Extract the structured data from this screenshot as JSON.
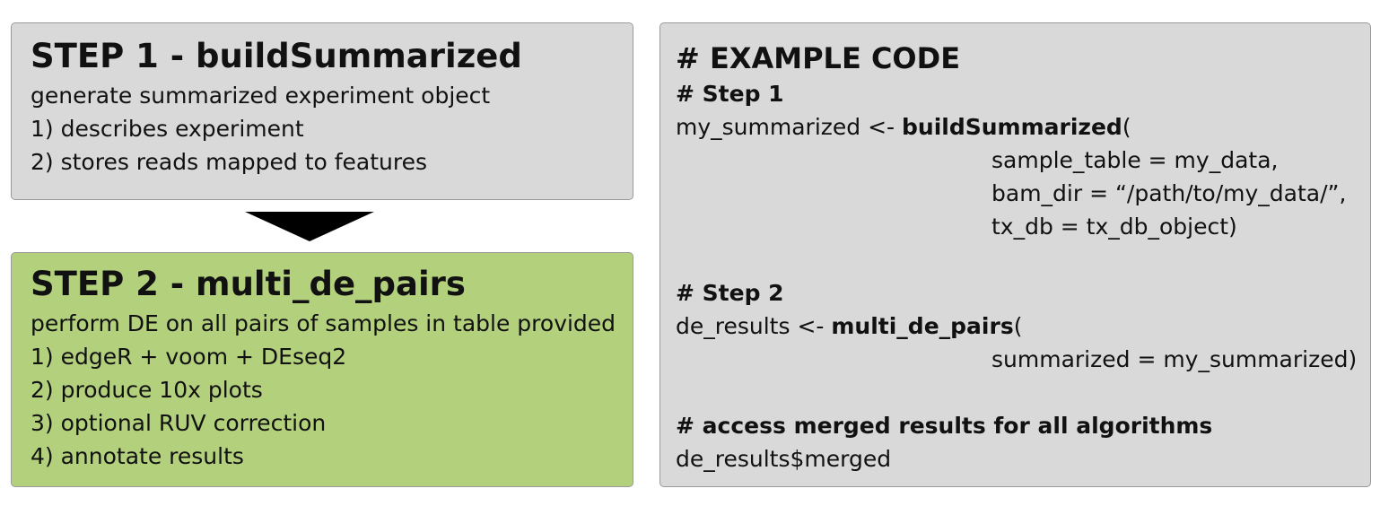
{
  "step1": {
    "title": "STEP 1 - buildSummarized",
    "description": "generate summarized experiment object",
    "items": [
      "1) describes experiment",
      "2) stores reads mapped to features"
    ],
    "color": "#d9d9d9"
  },
  "step2": {
    "title": "STEP 2 - multi_de_pairs",
    "description": "perform DE on all pairs of samples in table provided",
    "items": [
      "1) edgeR + voom + DEseq2",
      "2) produce 10x plots",
      "3) optional RUV correction",
      "4) annotate results"
    ],
    "color": "#b3d07d"
  },
  "arrow": {
    "icon": "down-triangle-arrow"
  },
  "code": {
    "title": "# EXAMPLE CODE",
    "step1_comment": "# Step 1",
    "step1_call_prefix": "my_summarized <- ",
    "step1_fn": "buildSummarized",
    "step1_open": "(",
    "step1_args": [
      "sample_table = my_data,",
      "bam_dir = “/path/to/my_data/”,",
      "tx_db = tx_db_object)"
    ],
    "step2_comment": "# Step 2",
    "step2_call_prefix": "de_results <- ",
    "step2_fn": "multi_de_pairs",
    "step2_open": "(",
    "step2_args": [
      "summarized = my_summarized)"
    ],
    "access_comment": "# access merged results for all algorithms",
    "access_line": "de_results$merged"
  }
}
